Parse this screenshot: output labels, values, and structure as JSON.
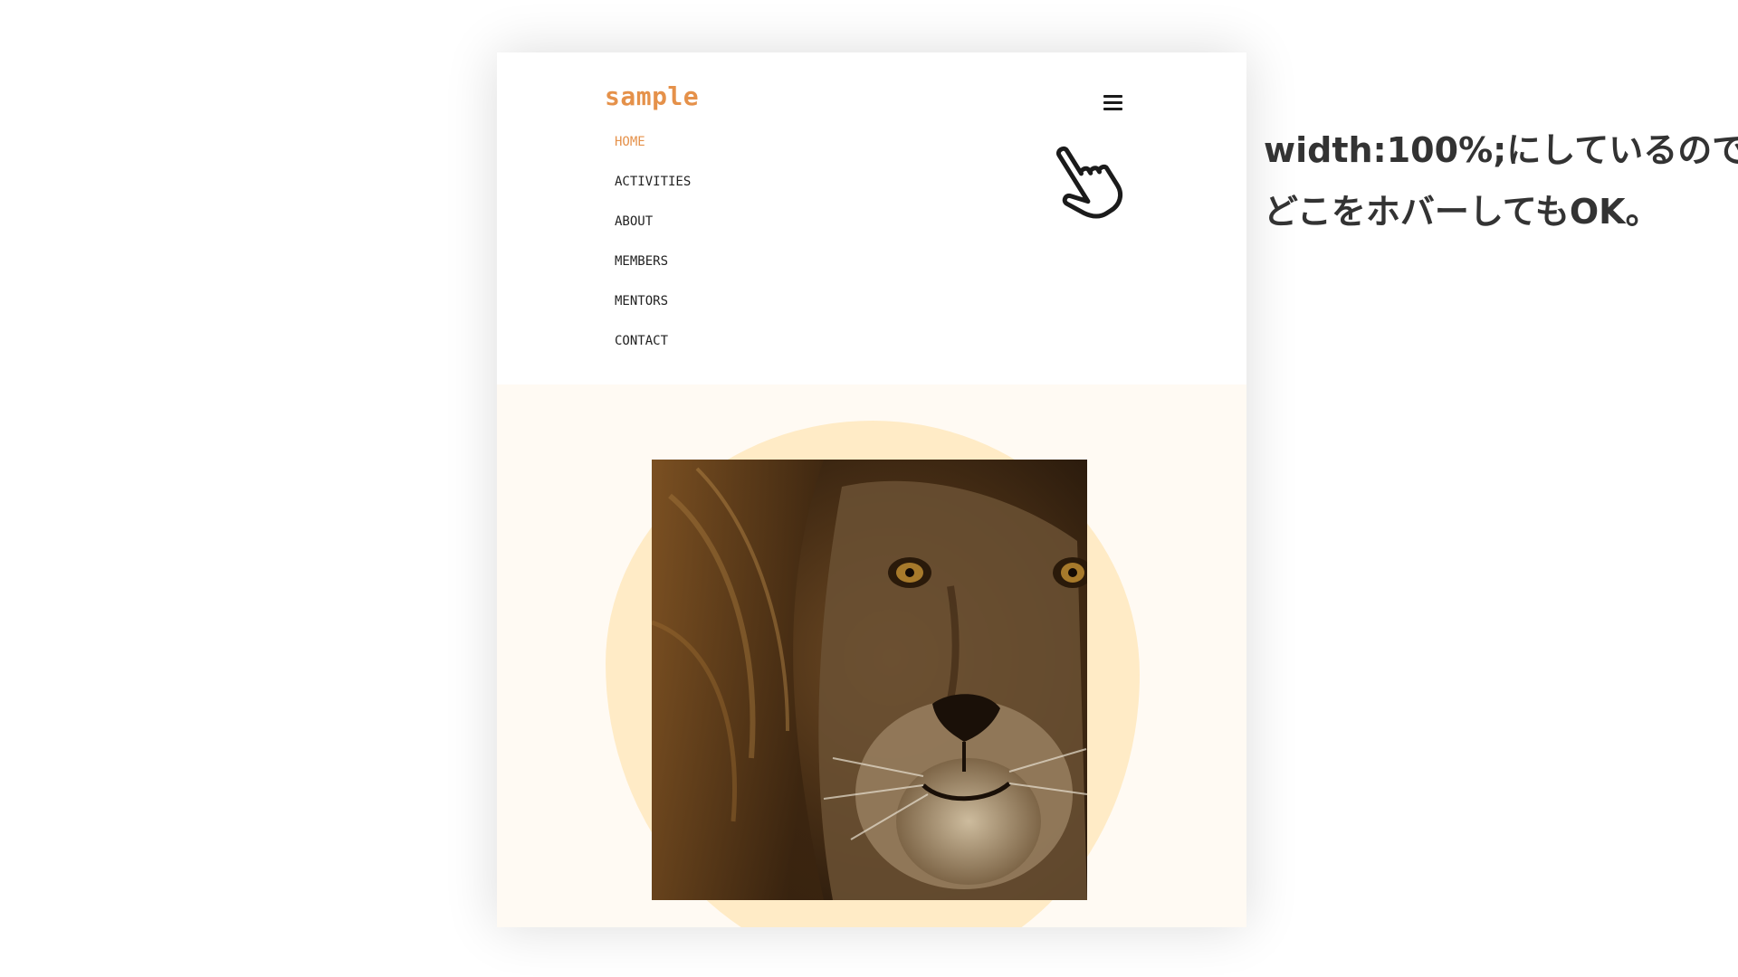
{
  "site": {
    "logo": "sample",
    "nav_items": [
      {
        "label": "HOME",
        "active": true
      },
      {
        "label": "ACTIVITIES",
        "active": false
      },
      {
        "label": "ABOUT",
        "active": false
      },
      {
        "label": "MEMBERS",
        "active": false
      },
      {
        "label": "MENTORS",
        "active": false
      },
      {
        "label": "CONTACT",
        "active": false
      }
    ],
    "menu_icon": "hamburger-icon",
    "cursor_icon": "hand-pointer-icon"
  },
  "annotation": {
    "line1": "width:100%;にしているので",
    "line2": "どこをホバーしてもOK。"
  },
  "colors": {
    "accent": "#e5914a",
    "hero_background": "#fffaf3",
    "blob": "#ffebc6",
    "text": "#222222"
  }
}
